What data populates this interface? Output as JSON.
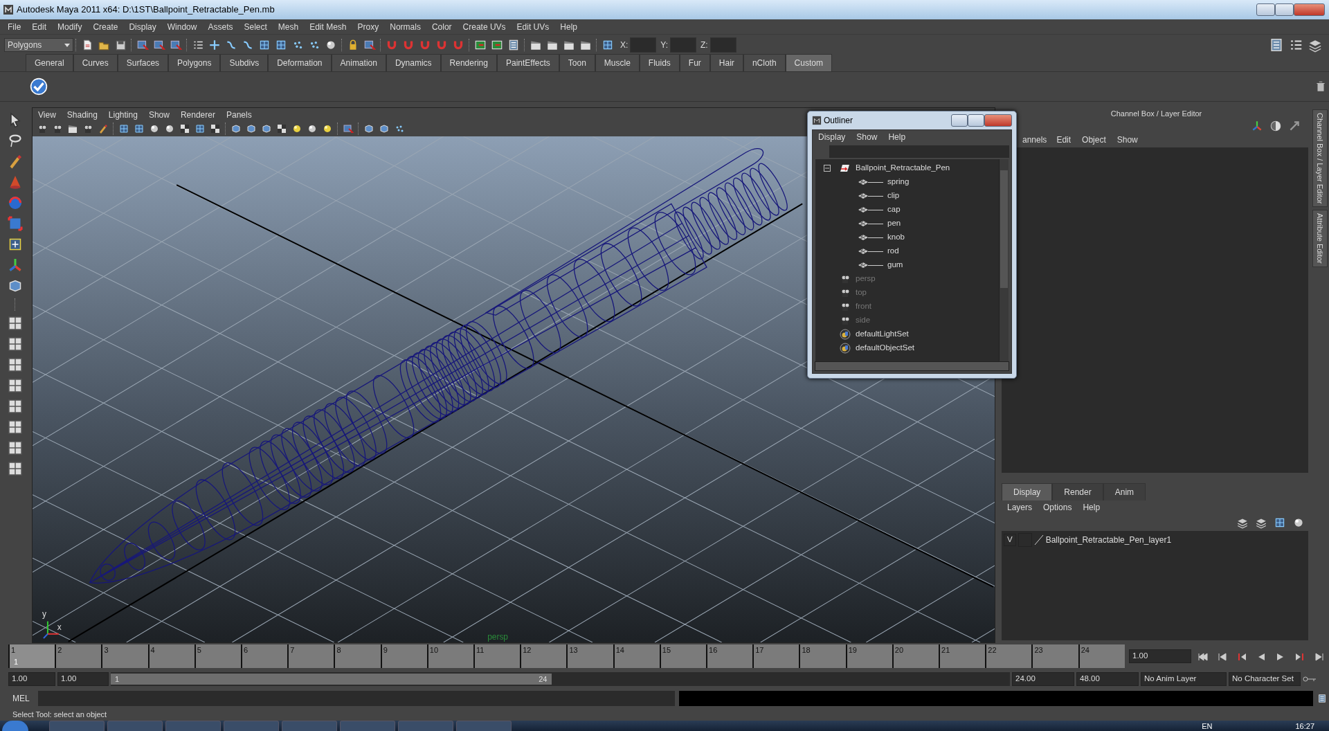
{
  "window": {
    "title": "Autodesk Maya 2011 x64: D:\\1ST\\Ballpoint_Retractable_Pen.mb"
  },
  "menu_bar": [
    "File",
    "Edit",
    "Modify",
    "Create",
    "Display",
    "Window",
    "Assets",
    "Select",
    "Mesh",
    "Edit Mesh",
    "Proxy",
    "Normals",
    "Color",
    "Create UVs",
    "Edit UVs",
    "Help"
  ],
  "status_line": {
    "mode_menu": "Polygons",
    "coordinate_labels": [
      "X:",
      "Y:",
      "Z:"
    ]
  },
  "shelf_tabs": [
    {
      "label": "General",
      "selected": false
    },
    {
      "label": "Curves",
      "selected": false
    },
    {
      "label": "Surfaces",
      "selected": false
    },
    {
      "label": "Polygons",
      "selected": false
    },
    {
      "label": "Subdivs",
      "selected": false
    },
    {
      "label": "Deformation",
      "selected": false
    },
    {
      "label": "Animation",
      "selected": false
    },
    {
      "label": "Dynamics",
      "selected": false
    },
    {
      "label": "Rendering",
      "selected": false
    },
    {
      "label": "PaintEffects",
      "selected": false
    },
    {
      "label": "Toon",
      "selected": false
    },
    {
      "label": "Muscle",
      "selected": false
    },
    {
      "label": "Fluids",
      "selected": false
    },
    {
      "label": "Fur",
      "selected": false
    },
    {
      "label": "Hair",
      "selected": false
    },
    {
      "label": "nCloth",
      "selected": false
    },
    {
      "label": "Custom",
      "selected": true
    }
  ],
  "viewport": {
    "menu": [
      "View",
      "Shading",
      "Lighting",
      "Show",
      "Renderer",
      "Panels"
    ],
    "axis_labels": [
      "y",
      "x"
    ],
    "camera_label": "persp"
  },
  "outliner": {
    "title": "Outliner",
    "menu": [
      "Display",
      "Show",
      "Help"
    ],
    "items": [
      {
        "label": "Ballpoint_Retractable_Pen",
        "kind": "group",
        "hidden": false,
        "expanded": true,
        "children": [
          {
            "label": "spring",
            "kind": "mesh",
            "hidden": false
          },
          {
            "label": "clip",
            "kind": "mesh",
            "hidden": false
          },
          {
            "label": "cap",
            "kind": "mesh",
            "hidden": false
          },
          {
            "label": "pen",
            "kind": "mesh",
            "hidden": false
          },
          {
            "label": "knob",
            "kind": "mesh",
            "hidden": false
          },
          {
            "label": "rod",
            "kind": "mesh",
            "hidden": false
          },
          {
            "label": "gum",
            "kind": "mesh",
            "hidden": false
          }
        ]
      },
      {
        "label": "persp",
        "kind": "camera",
        "hidden": true
      },
      {
        "label": "top",
        "kind": "camera",
        "hidden": true
      },
      {
        "label": "front",
        "kind": "camera",
        "hidden": true
      },
      {
        "label": "side",
        "kind": "camera",
        "hidden": true
      },
      {
        "label": "defaultLightSet",
        "kind": "set",
        "hidden": false
      },
      {
        "label": "defaultObjectSet",
        "kind": "set",
        "hidden": false
      }
    ]
  },
  "channel_box": {
    "title": "Channel Box / Layer Editor",
    "menu": [
      "annels",
      "Edit",
      "Object",
      "Show"
    ]
  },
  "side_tabs": [
    "Channel Box / Layer Editor",
    "Attribute Editor"
  ],
  "layer_editor": {
    "tabs": [
      {
        "label": "Display",
        "selected": true
      },
      {
        "label": "Render",
        "selected": false
      },
      {
        "label": "Anim",
        "selected": false
      }
    ],
    "menu": [
      "Layers",
      "Options",
      "Help"
    ],
    "layers": [
      {
        "visibility": "V",
        "name": "Ballpoint_Retractable_Pen_layer1"
      }
    ]
  },
  "timeline": {
    "ticks": [
      {
        "label": "1",
        "current": true
      },
      {
        "label": "2",
        "current": false
      },
      {
        "label": "3",
        "current": false
      },
      {
        "label": "4",
        "current": false
      },
      {
        "label": "5",
        "current": false
      },
      {
        "label": "6",
        "current": false
      },
      {
        "label": "7",
        "current": false
      },
      {
        "label": "8",
        "current": false
      },
      {
        "label": "9",
        "current": false
      },
      {
        "label": "10",
        "current": false
      },
      {
        "label": "11",
        "current": false
      },
      {
        "label": "12",
        "current": false
      },
      {
        "label": "13",
        "current": false
      },
      {
        "label": "14",
        "current": false
      },
      {
        "label": "15",
        "current": false
      },
      {
        "label": "16",
        "current": false
      },
      {
        "label": "17",
        "current": false
      },
      {
        "label": "18",
        "current": false
      },
      {
        "label": "19",
        "current": false
      },
      {
        "label": "20",
        "current": false
      },
      {
        "label": "21",
        "current": false
      },
      {
        "label": "22",
        "current": false
      },
      {
        "label": "23",
        "current": false
      },
      {
        "label": "24",
        "current": false
      }
    ],
    "current_frame": "1",
    "current_time": "1.00"
  },
  "range": {
    "start_time": "1.00",
    "range_start": "1.00",
    "level": 0.49,
    "slider_start": "1",
    "slider_end": "24",
    "range_end": "24.00",
    "end_time": "48.00",
    "anim_layer": "No Anim Layer",
    "character_set": "No Character Set"
  },
  "command_line": {
    "label": "MEL"
  },
  "help_line": "Select Tool: select an object",
  "taskbar": {
    "language": "EN",
    "clock": "16:27"
  }
}
